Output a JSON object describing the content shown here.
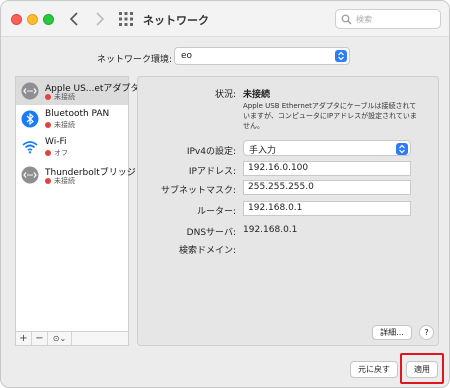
{
  "window": {
    "title": "ネットワーク"
  },
  "search": {
    "placeholder": "検索"
  },
  "location": {
    "label": "ネットワーク環境:",
    "value": "eo"
  },
  "services": [
    {
      "name": "Apple US...etアダプタ",
      "status": "未接続",
      "icon": "ethernet-icon"
    },
    {
      "name": "Bluetooth PAN",
      "status": "未接続",
      "icon": "bluetooth-icon"
    },
    {
      "name": "Wi-Fi",
      "status": "オフ",
      "icon": "wifi-icon"
    },
    {
      "name": "Thunderboltブリッジ",
      "status": "未接続",
      "icon": "ethernet-icon"
    }
  ],
  "sidebar_footer": {
    "add": "+",
    "remove": "−",
    "action": "⊙⌄"
  },
  "detail": {
    "status_label": "状況:",
    "status_value": "未接続",
    "status_description": "Apple USB Ethernetアダプタにケーブルは接続されていますが、コンピュータにIPアドレスが設定されていません。",
    "ipv4_label": "IPv4の設定:",
    "ipv4_value": "手入力",
    "ip_label": "IPアドレス:",
    "ip_value": "192.16.0.100",
    "subnet_label": "サブネットマスク:",
    "subnet_value": "255.255.255.0",
    "router_label": "ルーター:",
    "router_value": "192.168.0.1",
    "dns_label": "DNSサーバ:",
    "dns_value": "192.168.0.1",
    "search_domain_label": "検索ドメイン:",
    "advanced_label": "詳細...",
    "help_label": "?"
  },
  "buttons": {
    "revert": "元に戻す",
    "apply": "適用"
  },
  "colors": {
    "accent": "#2f7bf6",
    "status_red": "#e0443e",
    "highlight_red": "#e3141e"
  }
}
